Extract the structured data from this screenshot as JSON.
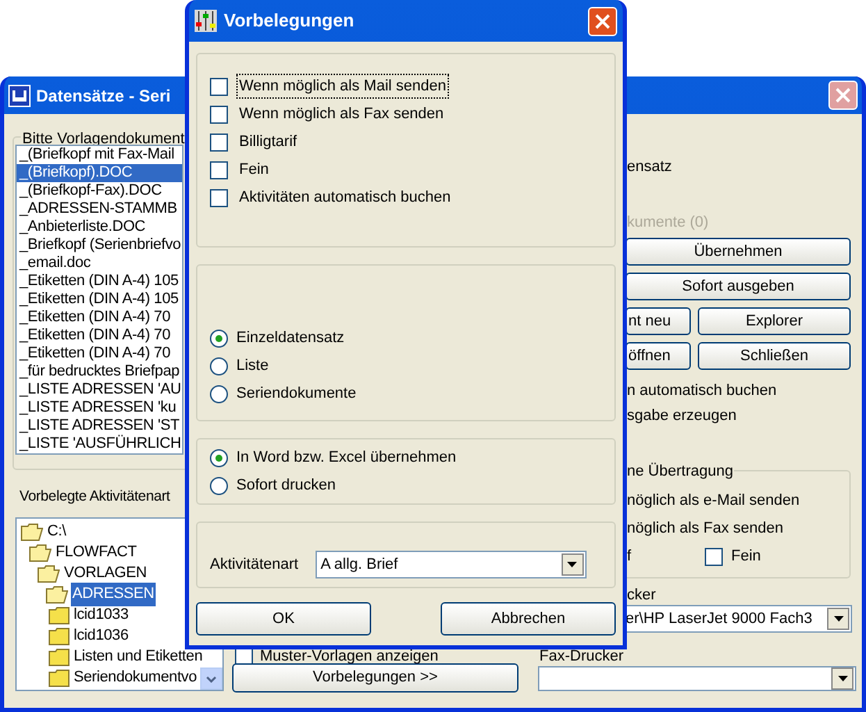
{
  "background_window": {
    "title": "Datensätze - Seri",
    "template_group": {
      "label": "Bitte Vorlagendokument",
      "items": [
        {
          "text": "_(Briefkopf mit Fax-Mail",
          "selected": false
        },
        {
          "text": "_(Briefkopf).DOC",
          "selected": true
        },
        {
          "text": "_(Briefkopf-Fax).DOC",
          "selected": false
        },
        {
          "text": "_ADRESSEN-STAMMB",
          "selected": false
        },
        {
          "text": "_Anbieterliste.DOC",
          "selected": false
        },
        {
          "text": "_Briefkopf (Serienbriefvo",
          "selected": false
        },
        {
          "text": "_email.doc",
          "selected": false
        },
        {
          "text": "_Etiketten (DIN A-4) 105",
          "selected": false
        },
        {
          "text": "_Etiketten (DIN A-4) 105",
          "selected": false
        },
        {
          "text": "_Etiketten (DIN A-4) 70",
          "selected": false
        },
        {
          "text": "_Etiketten (DIN A-4) 70",
          "selected": false
        },
        {
          "text": "_Etiketten (DIN A-4) 70",
          "selected": false
        },
        {
          "text": "_für bedrucktes Briefpap",
          "selected": false
        },
        {
          "text": "_LISTE ADRESSEN 'AU",
          "selected": false
        },
        {
          "text": "_LISTE ADRESSEN 'ku",
          "selected": false
        },
        {
          "text": "_LISTE ADRESSEN 'ST",
          "selected": false
        },
        {
          "text": "_LISTE 'AUSFÜHRLICH",
          "selected": false
        }
      ]
    },
    "activity_label": "Vorbelegte Aktivitätenart",
    "folder_tree": [
      {
        "label": "C:\\",
        "selected": false,
        "children": [
          {
            "label": "FLOWFACT",
            "selected": false,
            "children": [
              {
                "label": "VORLAGEN",
                "selected": false,
                "children": [
                  {
                    "label": "ADRESSEN",
                    "selected": true,
                    "children": [
                      {
                        "label": "lcid1033",
                        "selected": false
                      },
                      {
                        "label": "lcid1036",
                        "selected": false
                      },
                      {
                        "label": "Listen und Etiketten",
                        "selected": false
                      },
                      {
                        "label": "Seriendokumentvo",
                        "selected": false
                      }
                    ]
                  }
                ]
              }
            ]
          }
        ]
      }
    ],
    "templates_checkbox": {
      "label": "Muster-Vorlagen anzeigen",
      "checked": false
    },
    "presets_button": "Vorbelegungen >>",
    "right_panel": {
      "option_1": "ensatz",
      "option_2": {
        "label": "kumente (0)",
        "disabled": true
      },
      "buttons": [
        {
          "label": "Übernehmen",
          "kind": "wide"
        },
        {
          "label": "Sofort ausgeben",
          "kind": "wide"
        },
        {
          "label": "nt neu",
          "kind": "left"
        },
        {
          "label": "Explorer",
          "kind": "right"
        },
        {
          "label": "öffnen",
          "kind": "left"
        },
        {
          "label": "Schließen",
          "kind": "right"
        }
      ],
      "option_3": "n automatisch buchen",
      "option_4": "sgabe erzeugen",
      "transfer_group": {
        "label": "ne Übertragung",
        "line_1": "nöglich als e-Mail senden",
        "line_2": "nöglich als Fax senden",
        "line_3": "f",
        "fine_checkbox": {
          "label": "Fein",
          "checked": false
        }
      },
      "printer_label": "cker",
      "printer_value": "er\\HP LaserJet 9000 Fach3",
      "fax_label": "Fax-Drucker"
    }
  },
  "dialog": {
    "title": "Vorbelegungen",
    "checkboxes": [
      {
        "label": "Wenn möglich als Mail senden",
        "checked": false,
        "focused": true
      },
      {
        "label": "Wenn möglich als Fax senden",
        "checked": false,
        "focused": false
      },
      {
        "label": "Billigtarif",
        "checked": false,
        "focused": false
      },
      {
        "label": "Fein",
        "checked": false,
        "focused": false
      },
      {
        "label": "Aktivitäten automatisch buchen",
        "checked": false,
        "focused": false
      }
    ],
    "scope": [
      {
        "label": "Einzeldatensatz",
        "selected": true
      },
      {
        "label": "Liste",
        "selected": false
      },
      {
        "label": "Seriendokumente",
        "selected": false
      }
    ],
    "output": [
      {
        "label": "In Word bzw. Excel übernehmen",
        "selected": true
      },
      {
        "label": "Sofort drucken",
        "selected": false
      }
    ],
    "activity_label": "Aktivitätenart",
    "activity_value": "A allg. Brief",
    "buttons": [
      "OK",
      "Abbrechen"
    ]
  }
}
